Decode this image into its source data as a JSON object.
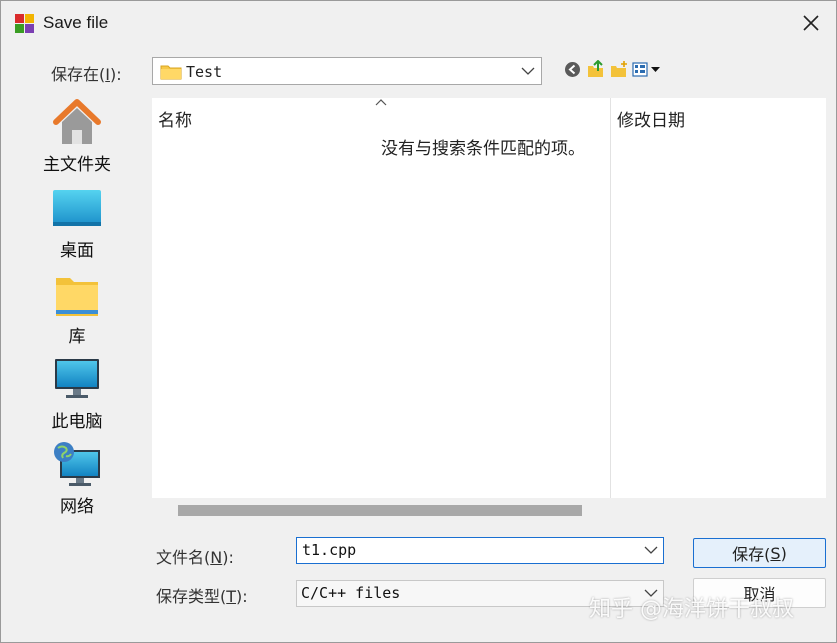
{
  "window": {
    "title": "Save file"
  },
  "save_in": {
    "label_prefix": "保存在(",
    "label_key": "I",
    "label_suffix": "):",
    "location": "Test"
  },
  "toolbar": {
    "icons": [
      "back-icon",
      "up-folder-icon",
      "new-folder-icon",
      "view-menu-icon"
    ]
  },
  "places": [
    {
      "label": "主文件夹",
      "icon": "home-icon"
    },
    {
      "label": "桌面",
      "icon": "desktop-icon"
    },
    {
      "label": "库",
      "icon": "library-folder-icon"
    },
    {
      "label": "此电脑",
      "icon": "computer-icon"
    },
    {
      "label": "网络",
      "icon": "network-icon"
    }
  ],
  "file_list": {
    "columns": [
      "名称",
      "修改日期"
    ],
    "empty_message": "没有与搜索条件匹配的项。"
  },
  "file_name": {
    "label_prefix": "文件名(",
    "label_key": "N",
    "label_suffix": "):",
    "value": "t1.cpp"
  },
  "file_type": {
    "label_prefix": "保存类型(",
    "label_key": "T",
    "label_suffix": "):",
    "value": "C/C++ files"
  },
  "buttons": {
    "save_prefix": "保存(",
    "save_key": "S",
    "save_suffix": ")",
    "cancel": "取消"
  },
  "watermark": "知乎 @海洋饼干叔叔",
  "colors": {
    "accent": "#1a6fd1",
    "background": "#f0f0f0"
  }
}
